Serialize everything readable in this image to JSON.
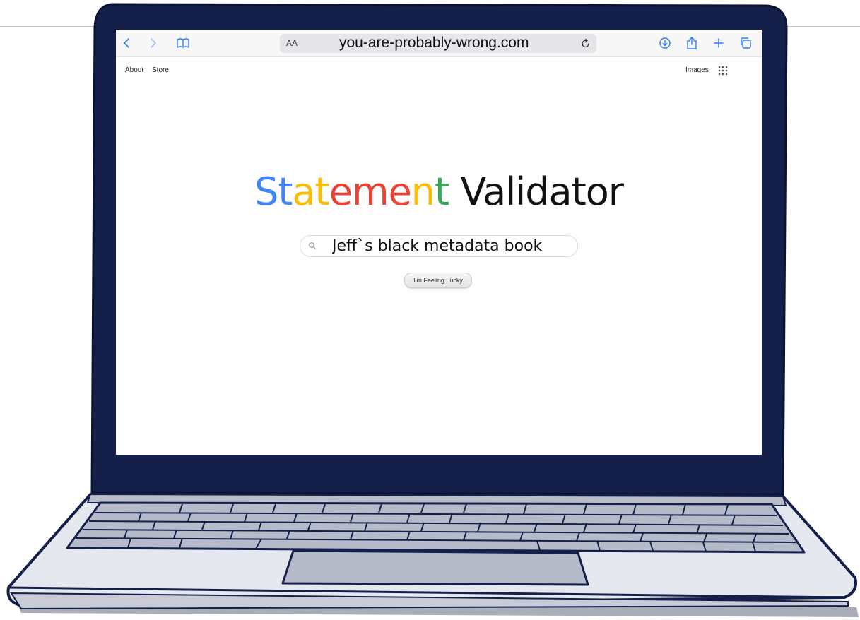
{
  "browser": {
    "url": "you-are-probably-wrong.com",
    "text_size_label": "AA"
  },
  "page": {
    "nav_left": [
      "About",
      "Store"
    ],
    "nav_right": [
      "Images"
    ],
    "logo": {
      "letters": [
        {
          "ch": "S",
          "color": "#4285F4"
        },
        {
          "ch": "t",
          "color": "#4285F4"
        },
        {
          "ch": "a",
          "color": "#FBBC05"
        },
        {
          "ch": "t",
          "color": "#FBBC05"
        },
        {
          "ch": "e",
          "color": "#EA4335"
        },
        {
          "ch": "m",
          "color": "#EA4335"
        },
        {
          "ch": "e",
          "color": "#EA4335"
        },
        {
          "ch": "n",
          "color": "#FBBC05"
        },
        {
          "ch": "t",
          "color": "#34A853"
        }
      ],
      "rest": " Validator",
      "rest_color": "#111111"
    },
    "search": {
      "value": "Jeff`s black metadata book"
    },
    "lucky_label": "I'm Feeling Lucky"
  },
  "colors": {
    "laptop_frame": "#14204a",
    "laptop_body": "#e6e8f0",
    "toolbar_accent": "#2f7df6"
  },
  "icons": {
    "toolbar_left": [
      "back-icon",
      "forward-icon",
      "bookmarks-icon"
    ],
    "toolbar_right": [
      "download-icon",
      "share-icon",
      "new-tab-icon",
      "tabs-icon"
    ],
    "address": [
      "reload-icon"
    ],
    "page": [
      "apps-grid-icon",
      "search-icon"
    ]
  }
}
